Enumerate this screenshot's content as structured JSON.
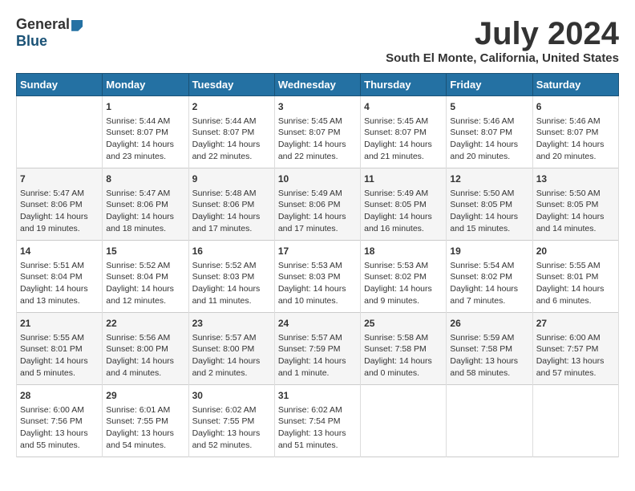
{
  "header": {
    "logo_general": "General",
    "logo_blue": "Blue",
    "month_title": "July 2024",
    "location": "South El Monte, California, United States"
  },
  "calendar": {
    "days_of_week": [
      "Sunday",
      "Monday",
      "Tuesday",
      "Wednesday",
      "Thursday",
      "Friday",
      "Saturday"
    ],
    "weeks": [
      [
        {
          "day": "",
          "content": ""
        },
        {
          "day": "1",
          "content": "Sunrise: 5:44 AM\nSunset: 8:07 PM\nDaylight: 14 hours\nand 23 minutes."
        },
        {
          "day": "2",
          "content": "Sunrise: 5:44 AM\nSunset: 8:07 PM\nDaylight: 14 hours\nand 22 minutes."
        },
        {
          "day": "3",
          "content": "Sunrise: 5:45 AM\nSunset: 8:07 PM\nDaylight: 14 hours\nand 22 minutes."
        },
        {
          "day": "4",
          "content": "Sunrise: 5:45 AM\nSunset: 8:07 PM\nDaylight: 14 hours\nand 21 minutes."
        },
        {
          "day": "5",
          "content": "Sunrise: 5:46 AM\nSunset: 8:07 PM\nDaylight: 14 hours\nand 20 minutes."
        },
        {
          "day": "6",
          "content": "Sunrise: 5:46 AM\nSunset: 8:07 PM\nDaylight: 14 hours\nand 20 minutes."
        }
      ],
      [
        {
          "day": "7",
          "content": "Sunrise: 5:47 AM\nSunset: 8:06 PM\nDaylight: 14 hours\nand 19 minutes."
        },
        {
          "day": "8",
          "content": "Sunrise: 5:47 AM\nSunset: 8:06 PM\nDaylight: 14 hours\nand 18 minutes."
        },
        {
          "day": "9",
          "content": "Sunrise: 5:48 AM\nSunset: 8:06 PM\nDaylight: 14 hours\nand 17 minutes."
        },
        {
          "day": "10",
          "content": "Sunrise: 5:49 AM\nSunset: 8:06 PM\nDaylight: 14 hours\nand 17 minutes."
        },
        {
          "day": "11",
          "content": "Sunrise: 5:49 AM\nSunset: 8:05 PM\nDaylight: 14 hours\nand 16 minutes."
        },
        {
          "day": "12",
          "content": "Sunrise: 5:50 AM\nSunset: 8:05 PM\nDaylight: 14 hours\nand 15 minutes."
        },
        {
          "day": "13",
          "content": "Sunrise: 5:50 AM\nSunset: 8:05 PM\nDaylight: 14 hours\nand 14 minutes."
        }
      ],
      [
        {
          "day": "14",
          "content": "Sunrise: 5:51 AM\nSunset: 8:04 PM\nDaylight: 14 hours\nand 13 minutes."
        },
        {
          "day": "15",
          "content": "Sunrise: 5:52 AM\nSunset: 8:04 PM\nDaylight: 14 hours\nand 12 minutes."
        },
        {
          "day": "16",
          "content": "Sunrise: 5:52 AM\nSunset: 8:03 PM\nDaylight: 14 hours\nand 11 minutes."
        },
        {
          "day": "17",
          "content": "Sunrise: 5:53 AM\nSunset: 8:03 PM\nDaylight: 14 hours\nand 10 minutes."
        },
        {
          "day": "18",
          "content": "Sunrise: 5:53 AM\nSunset: 8:02 PM\nDaylight: 14 hours\nand 9 minutes."
        },
        {
          "day": "19",
          "content": "Sunrise: 5:54 AM\nSunset: 8:02 PM\nDaylight: 14 hours\nand 7 minutes."
        },
        {
          "day": "20",
          "content": "Sunrise: 5:55 AM\nSunset: 8:01 PM\nDaylight: 14 hours\nand 6 minutes."
        }
      ],
      [
        {
          "day": "21",
          "content": "Sunrise: 5:55 AM\nSunset: 8:01 PM\nDaylight: 14 hours\nand 5 minutes."
        },
        {
          "day": "22",
          "content": "Sunrise: 5:56 AM\nSunset: 8:00 PM\nDaylight: 14 hours\nand 4 minutes."
        },
        {
          "day": "23",
          "content": "Sunrise: 5:57 AM\nSunset: 8:00 PM\nDaylight: 14 hours\nand 2 minutes."
        },
        {
          "day": "24",
          "content": "Sunrise: 5:57 AM\nSunset: 7:59 PM\nDaylight: 14 hours\nand 1 minute."
        },
        {
          "day": "25",
          "content": "Sunrise: 5:58 AM\nSunset: 7:58 PM\nDaylight: 14 hours\nand 0 minutes."
        },
        {
          "day": "26",
          "content": "Sunrise: 5:59 AM\nSunset: 7:58 PM\nDaylight: 13 hours\nand 58 minutes."
        },
        {
          "day": "27",
          "content": "Sunrise: 6:00 AM\nSunset: 7:57 PM\nDaylight: 13 hours\nand 57 minutes."
        }
      ],
      [
        {
          "day": "28",
          "content": "Sunrise: 6:00 AM\nSunset: 7:56 PM\nDaylight: 13 hours\nand 55 minutes."
        },
        {
          "day": "29",
          "content": "Sunrise: 6:01 AM\nSunset: 7:55 PM\nDaylight: 13 hours\nand 54 minutes."
        },
        {
          "day": "30",
          "content": "Sunrise: 6:02 AM\nSunset: 7:55 PM\nDaylight: 13 hours\nand 52 minutes."
        },
        {
          "day": "31",
          "content": "Sunrise: 6:02 AM\nSunset: 7:54 PM\nDaylight: 13 hours\nand 51 minutes."
        },
        {
          "day": "",
          "content": ""
        },
        {
          "day": "",
          "content": ""
        },
        {
          "day": "",
          "content": ""
        }
      ]
    ]
  }
}
